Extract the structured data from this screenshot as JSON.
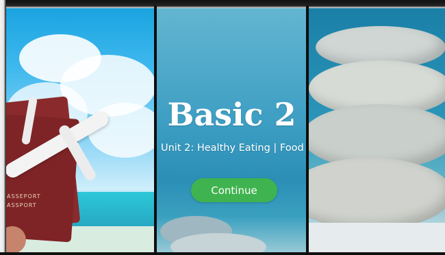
{
  "slide": {
    "title": "Basic 2",
    "subtitle": "Unit 2: Healthy Eating | Food",
    "continue_label": "Continue"
  },
  "left_photo": {
    "passport_text_1": "ASSEPORT",
    "passport_text_2": "ASSPORT"
  },
  "colors": {
    "button": "#3fb34f",
    "title": "#ffffff",
    "divider": "#0e0e0e"
  },
  "icons": [
    "airplane-icon",
    "passport-icon"
  ]
}
